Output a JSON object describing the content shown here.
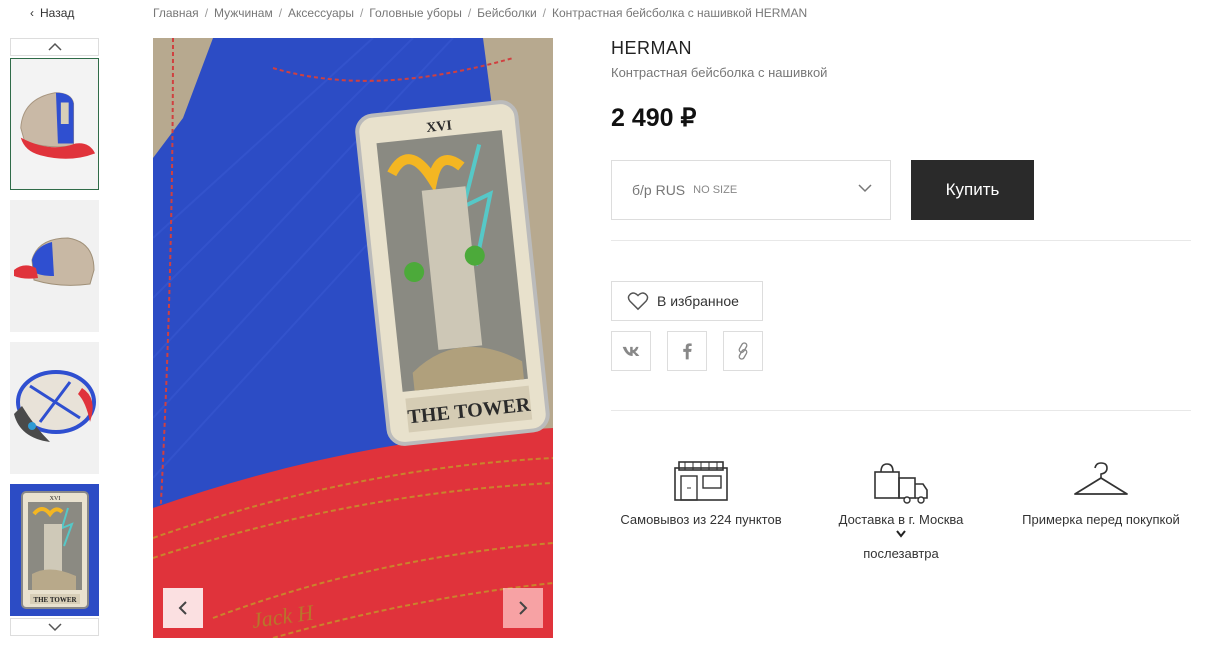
{
  "nav": {
    "back_label": "Назад",
    "breadcrumbs": [
      "Главная",
      "Мужчинам",
      "Аксессуары",
      "Головные уборы",
      "Бейсболки",
      "Контрастная бейсболка с нашивкой HERMAN"
    ]
  },
  "gallery": {
    "thumbnails": [
      "thumb-1",
      "thumb-2",
      "thumb-3",
      "thumb-4"
    ],
    "active_thumbnail": 0,
    "patch_title": "THE TOWER",
    "patch_numeral": "XVI",
    "brim_text": "Jack H"
  },
  "product": {
    "brand": "HERMAN",
    "name": "Контрастная бейсболка с нашивкой",
    "price": "2 490 ₽",
    "size_value": "б/р RUS",
    "size_note": "NO SIZE",
    "buy_label": "Купить",
    "favorite_label": "В избранное"
  },
  "share": {
    "vk": "vk-icon",
    "facebook": "facebook-icon",
    "link": "link-icon"
  },
  "features": {
    "pickup_label": "Самовывоз из 224 пунктов",
    "delivery_prefix": "Доставка в",
    "delivery_city": "г. Москва",
    "delivery_when": "послезавтра",
    "fitting_label": "Примерка перед покупкой"
  },
  "colors": {
    "buy_button": "#2a2a2a",
    "active_thumb_border": "#2f6b48",
    "cap_blue": "#2c4cc5",
    "cap_red": "#e0333b"
  }
}
